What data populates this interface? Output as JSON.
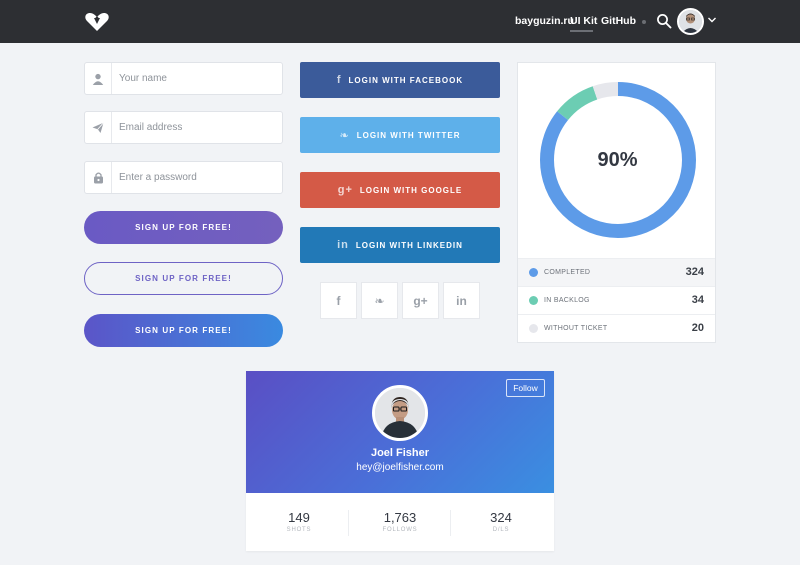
{
  "header": {
    "nav": [
      "bayguzin.ru",
      "UI Kit",
      "GitHub"
    ],
    "active_nav": "UI Kit"
  },
  "form": {
    "name_placeholder": "Your name",
    "email_placeholder": "Email address",
    "password_placeholder": "Enter a password"
  },
  "signup_buttons": [
    "SIGN UP FOR FREE!",
    "SIGN UP FOR FREE!",
    "SIGN UP FOR FREE!"
  ],
  "social_buttons": {
    "facebook": {
      "icon": "f",
      "label": "LOGIN WITH FACEBOOK",
      "color": "#3b5b9a"
    },
    "twitter": {
      "icon": "❧",
      "label": "LOGIN WITH TWITTER",
      "color": "#5eb0ea"
    },
    "google": {
      "icon": "g+",
      "label": "LOGIN WITH GOOGLE",
      "color": "#d45a47"
    },
    "linkedin": {
      "icon": "in",
      "label": "LOGIN WITH LINKEDIN",
      "color": "#2279b7"
    }
  },
  "social_squares": [
    "f",
    "❧",
    "g+",
    "in"
  ],
  "chart_data": {
    "type": "pie",
    "center_label": "90%",
    "categories": [
      "COMPLETED",
      "IN BACKLOG",
      "WITHOUT TICKET"
    ],
    "values": [
      324,
      34,
      20
    ],
    "colors": [
      "#5d9be8",
      "#6ccdb3",
      "#e6e7ec"
    ]
  },
  "profile": {
    "follow_label": "Follow",
    "name": "Joel Fisher",
    "email": "hey@joelfisher.com",
    "stats": [
      {
        "value": "149",
        "label": "SHOTS"
      },
      {
        "value": "1,763",
        "label": "FOLLOWS"
      },
      {
        "value": "324",
        "label": "D/LS"
      }
    ]
  }
}
